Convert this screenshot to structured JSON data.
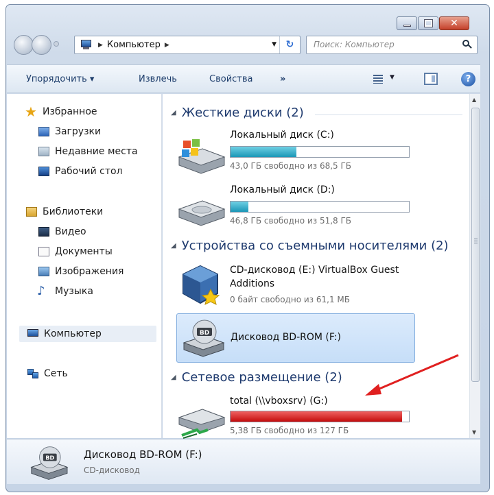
{
  "window": {
    "caption_buttons": {
      "minimize": "minimize",
      "maximize": "maximize",
      "close": "✕"
    }
  },
  "address_bar": {
    "location": "Компьютер",
    "search_placeholder": "Поиск: Компьютер"
  },
  "command_bar": {
    "organize": "Упорядочить ▾",
    "extract": "Извлечь",
    "properties": "Свойства",
    "more": "»"
  },
  "sidebar": {
    "favorites": "Избранное",
    "downloads": "Загрузки",
    "recent": "Недавние места",
    "desktop": "Рабочий стол",
    "libraries": "Библиотеки",
    "video": "Видео",
    "documents": "Документы",
    "images": "Изображения",
    "music": "Музыка",
    "computer": "Компьютер",
    "network": "Сеть"
  },
  "groups": {
    "hard_disks": "Жесткие диски (2)",
    "removable": "Устройства со съемными носителями (2)",
    "network": "Сетевое размещение (2)"
  },
  "drives": {
    "c": {
      "name": "Локальный диск (C:)",
      "free": "43,0 ГБ свободно из 68,5 ГБ",
      "used_fraction": 0.37
    },
    "d": {
      "name": "Локальный диск (D:)",
      "free": "46,8 ГБ свободно из 51,8 ГБ",
      "used_fraction": 0.1
    },
    "e": {
      "name_line1": "CD-дисковод (E:) VirtualBox Guest",
      "name_line2": "Additions",
      "free": "0 байт свободно из 61,1 МБ"
    },
    "f": {
      "name": "Дисковод BD-ROM (F:)"
    },
    "g": {
      "name": "total (\\\\vboxsrv) (G:)",
      "free": "5,38 ГБ свободно из 127 ГБ",
      "used_fraction": 0.96
    }
  },
  "details": {
    "name": "Дисковод BD-ROM (F:)",
    "type": "CD-дисковод"
  },
  "colors": {
    "bar_normal": "#1b96b6",
    "bar_full": "#c40c0c",
    "selection": "#c6def8",
    "annotation_arrow": "#e02020"
  }
}
